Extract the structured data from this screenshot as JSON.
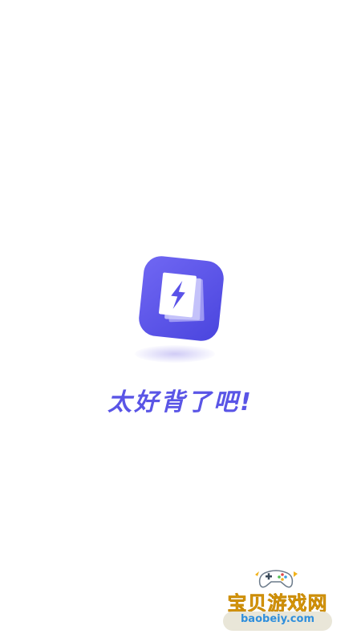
{
  "splash": {
    "slogan": "太好背了吧!",
    "logo_icon": "lightning-bolt-document-icon",
    "colors": {
      "logo_gradient_start": "#6d63f2",
      "logo_gradient_end": "#4a45e0",
      "slogan": "#5a55e6",
      "background": "#ffffff"
    }
  },
  "watermark": {
    "title": "宝贝游戏网",
    "url": "baobeiy.com",
    "icon": "gamepad-icon",
    "colors": {
      "title": "#f2b21b",
      "url": "#2f8fdc"
    }
  }
}
